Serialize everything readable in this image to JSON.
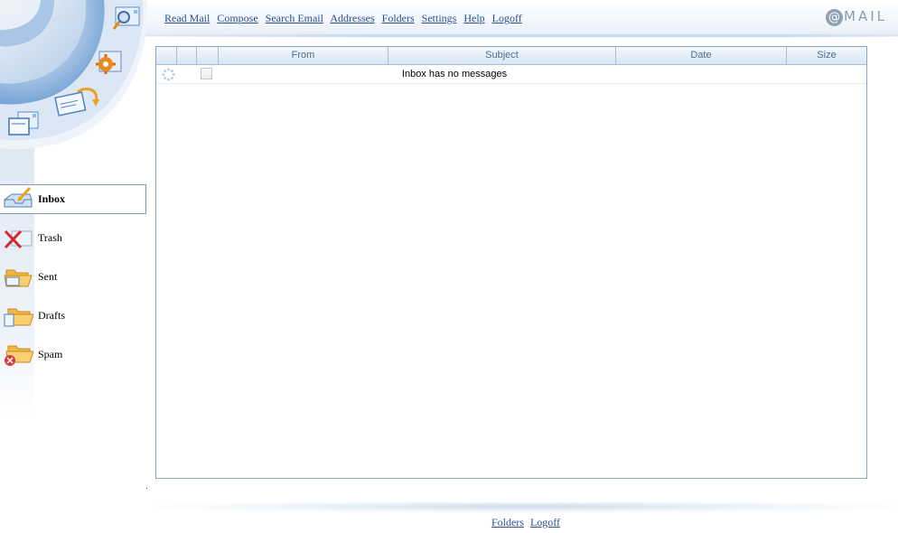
{
  "top_nav": {
    "items": [
      {
        "id": "read-mail",
        "label": "Read Mail"
      },
      {
        "id": "compose",
        "label": "Compose"
      },
      {
        "id": "search-email",
        "label": "Search Email"
      },
      {
        "id": "addresses",
        "label": "Addresses"
      },
      {
        "id": "folders",
        "label": "Folders"
      },
      {
        "id": "settings",
        "label": "Settings"
      },
      {
        "id": "help",
        "label": "Help"
      },
      {
        "id": "logoff",
        "label": "Logoff"
      }
    ]
  },
  "logo": {
    "at": "@",
    "text": "MAIL"
  },
  "sidebar": {
    "quick_icons": [
      "search-mail-icon",
      "settings-gear-icon",
      "reply-mail-icon",
      "compose-mail-icon"
    ],
    "folders": [
      {
        "id": "inbox",
        "label": "Inbox",
        "icon": "inbox-tray-icon",
        "active": true
      },
      {
        "id": "trash",
        "label": "Trash",
        "icon": "trash-icon",
        "active": false
      },
      {
        "id": "sent",
        "label": "Sent",
        "icon": "sent-folder-icon",
        "active": false
      },
      {
        "id": "drafts",
        "label": "Drafts",
        "icon": "drafts-folder-icon",
        "active": false
      },
      {
        "id": "spam",
        "label": "Spam",
        "icon": "spam-folder-icon",
        "active": false
      }
    ]
  },
  "message_list": {
    "columns": [
      "",
      "",
      "",
      "From",
      "Subject",
      "Date",
      "Size"
    ],
    "empty_message": "Inbox has no messages"
  },
  "footer": {
    "items": [
      {
        "id": "folders",
        "label": "Folders"
      },
      {
        "id": "logoff",
        "label": "Logoff"
      }
    ]
  },
  "colors": {
    "link": "#2a4f8f",
    "grid_border": "#86a6c6",
    "header_text": "#4f6b8e",
    "accent_blue": "#6e9fd3"
  }
}
